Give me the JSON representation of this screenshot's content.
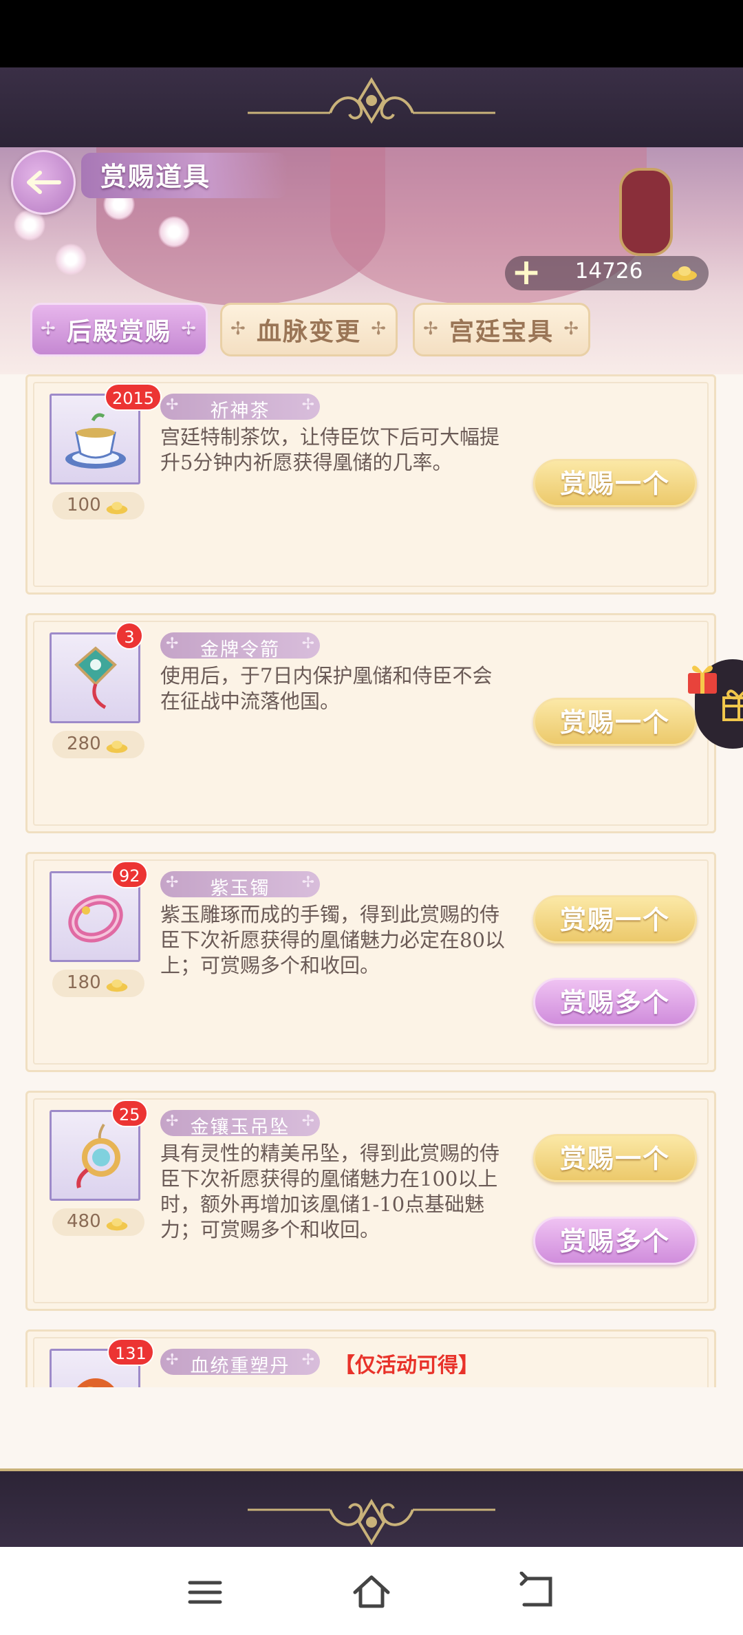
{
  "header": {
    "title": "赏赐道具"
  },
  "currency": {
    "value": "14726"
  },
  "tabs": [
    {
      "label": "后殿赏赐",
      "active": true
    },
    {
      "label": "血脉变更",
      "active": false
    },
    {
      "label": "宫廷宝具",
      "active": false
    }
  ],
  "items": [
    {
      "name": "祈神茶",
      "count": "2015",
      "price": "100",
      "icon": "tea-cup-icon",
      "description": "宫廷特制茶饮，让侍臣饮下后可大幅提升5分钟内祈愿获得凰储的几率。",
      "buttons": [
        "赏赐一个"
      ]
    },
    {
      "name": "金牌令箭",
      "count": "3",
      "price": "280",
      "icon": "token-pendant-icon",
      "description": "使用后，于7日内保护凰储和侍臣不会在征战中流落他国。",
      "buttons": [
        "赏赐一个"
      ]
    },
    {
      "name": "紫玉镯",
      "count": "92",
      "price": "180",
      "icon": "jade-bracelet-icon",
      "description": "紫玉雕琢而成的手镯，得到此赏赐的侍臣下次祈愿获得的凰储魅力必定在80以上；可赏赐多个和收回。",
      "buttons": [
        "赏赐一个",
        "赏赐多个"
      ]
    },
    {
      "name": "金镶玉吊坠",
      "count": "25",
      "price": "480",
      "icon": "jade-pendant-icon",
      "description": "具有灵性的精美吊坠，得到此赏赐的侍臣下次祈愿获得的凰储魅力在100以上时，额外再增加该凰储1-10点基础魅力；可赏赐多个和收回。",
      "buttons": [
        "赏赐一个",
        "赏赐多个"
      ]
    },
    {
      "name": "血统重塑丹",
      "count": "131",
      "note": "【仅活动可得】",
      "icon": "red-pill-icon"
    }
  ],
  "colors": {
    "accent_gold": "#ecc96b",
    "accent_purple": "#d08ddc",
    "badge_red": "#ec3433",
    "frame_dark": "#2c2436"
  }
}
